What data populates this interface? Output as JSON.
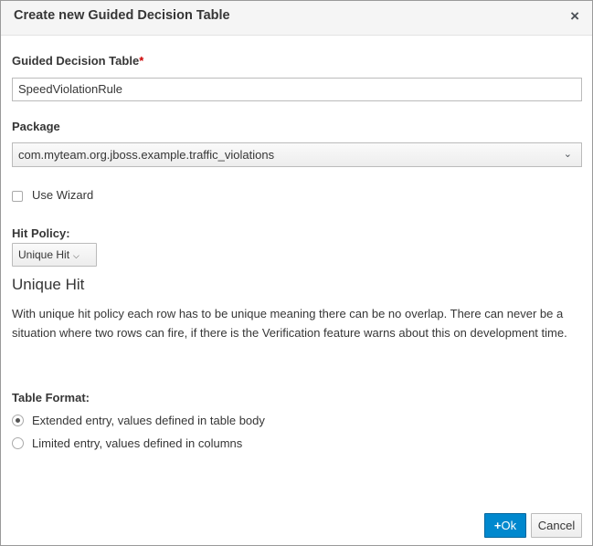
{
  "dialog": {
    "title": "Create new Guided Decision Table",
    "close_icon": "×"
  },
  "form": {
    "table_label": "Guided Decision Table",
    "required_marker": "*",
    "table_value": "SpeedViolationRule",
    "package_label": "Package",
    "package_value": "com.myteam.org.jboss.example.traffic_violations",
    "use_wizard_label": "Use Wizard",
    "use_wizard_checked": false,
    "hit_policy_label": "Hit Policy:",
    "hit_policy_value": "Unique Hit",
    "policy_title": "Unique Hit",
    "policy_description": "With unique hit policy each row has to be unique meaning there can be no overlap. There can never be a situation where two rows can fire, if there is the Verification feature warns about this on development time.",
    "table_format_label": "Table Format:",
    "table_format_options": [
      {
        "label": "Extended entry, values defined in table body",
        "selected": true
      },
      {
        "label": "Limited entry, values defined in columns",
        "selected": false
      }
    ]
  },
  "footer": {
    "ok_icon": "+",
    "ok_label": "Ok",
    "cancel_label": "Cancel"
  },
  "colors": {
    "primary": "#0088ce",
    "required": "#cc0000"
  }
}
